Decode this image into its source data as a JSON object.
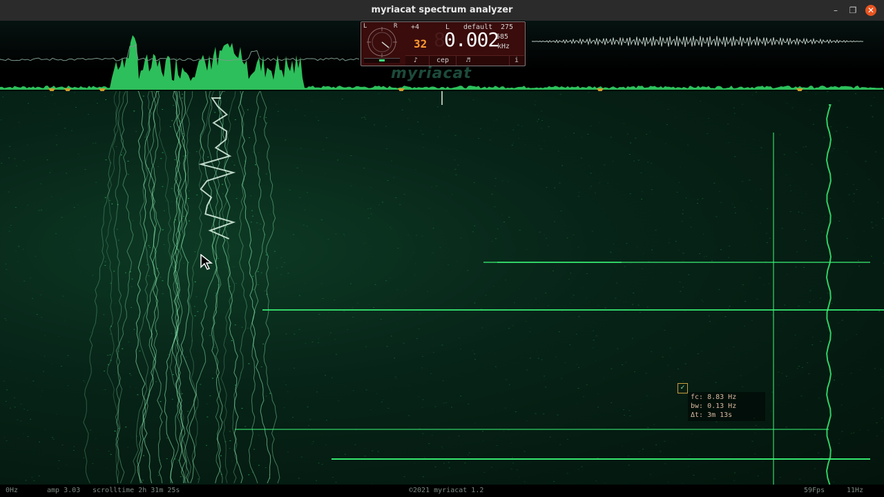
{
  "window": {
    "title": "myriacat spectrum analyzer",
    "minimize_icon": "minimize-icon",
    "maximize_icon": "maximize-icon",
    "close_icon": "close-icon"
  },
  "panel": {
    "channel_offset": "+4",
    "channel": "L",
    "preset": "default",
    "preset_value": "275",
    "octave_display": "32",
    "frequency": "0.002",
    "frequency_sub": "585",
    "frequency_unit": "kHz",
    "dial_left": "L",
    "dial_right": "R",
    "buttons": [
      "♪",
      "cep",
      "♬",
      "i"
    ]
  },
  "watermark": "myriacat",
  "tooltip": {
    "fc": "fc: 8.83 Hz",
    "bw": "bw: 0.13 Hz",
    "dt": "Δt: 3m 13s"
  },
  "status": {
    "min_freq": "0Hz",
    "amp": "amp 3.03",
    "scrolltime": "scrolltime 2h 31m 25s",
    "copyright": "©2021 myriacat 1.2",
    "fps": "59Fps",
    "max_freq": "11Hz"
  },
  "colors": {
    "accent_green": "#3cff7a",
    "marker_gold": "#d0a030",
    "close_orange": "#e95420"
  }
}
